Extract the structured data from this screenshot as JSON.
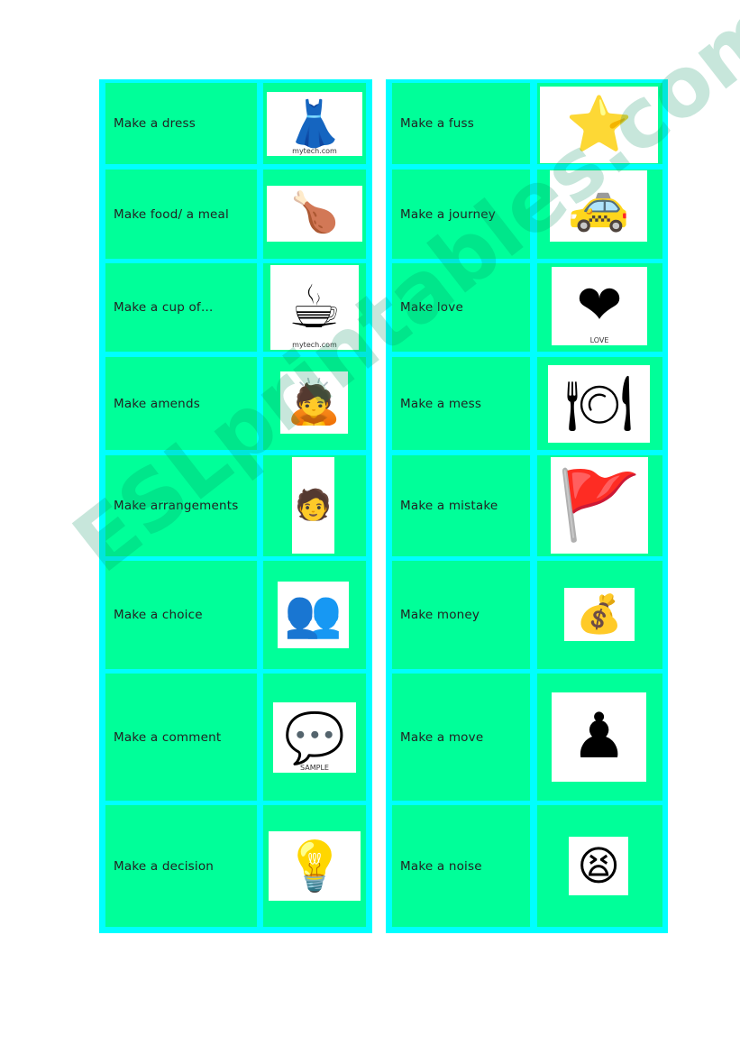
{
  "left_column": [
    {
      "phrase": "Make a dress",
      "icon": "dress-icon",
      "glyph": "👗",
      "caption": "mytech.com"
    },
    {
      "phrase": "Make food/ a meal",
      "icon": "roast-chicken-icon",
      "glyph": "🍗"
    },
    {
      "phrase": "Make a cup of…",
      "icon": "teacup-icon",
      "glyph": "☕",
      "caption": "mytech.com"
    },
    {
      "phrase": "Make amends",
      "icon": "apologizing-figure-icon",
      "glyph": "🙇"
    },
    {
      "phrase": "Make arrangements",
      "icon": "thinking-man-icon",
      "glyph": "🧑"
    },
    {
      "phrase": "Make a choice",
      "icon": "people-at-table-icon",
      "glyph": "👥"
    },
    {
      "phrase": "Make a comment",
      "icon": "speech-bubble-icon",
      "glyph": "💬",
      "caption": "SAMPLE"
    },
    {
      "phrase": "Make a decision",
      "icon": "lightbulb-icon",
      "glyph": "💡"
    }
  ],
  "right_column": [
    {
      "phrase": "Make a fuss",
      "icon": "angry-star-icon",
      "glyph": "⭐"
    },
    {
      "phrase": "Make a journey",
      "icon": "car-icon",
      "glyph": "🚕"
    },
    {
      "phrase": "Make love",
      "icon": "love-heart-icon",
      "glyph": "❤",
      "caption": "LOVE"
    },
    {
      "phrase": "Make a mess",
      "icon": "messy-kitchen-icon",
      "glyph": "🍽"
    },
    {
      "phrase": "Make a mistake",
      "icon": "semaphore-flags-icon",
      "glyph": "🚩"
    },
    {
      "phrase": "Make money",
      "icon": "money-bag-icon",
      "glyph": "💰"
    },
    {
      "phrase": "Make a move",
      "icon": "chess-players-icon",
      "glyph": "♟"
    },
    {
      "phrase": "Make a noise",
      "icon": "shouting-face-icon",
      "glyph": "😫"
    }
  ],
  "colors": {
    "frame": "#00ffff",
    "cell": "#00ff99"
  },
  "watermark": "ESLprintables.com"
}
